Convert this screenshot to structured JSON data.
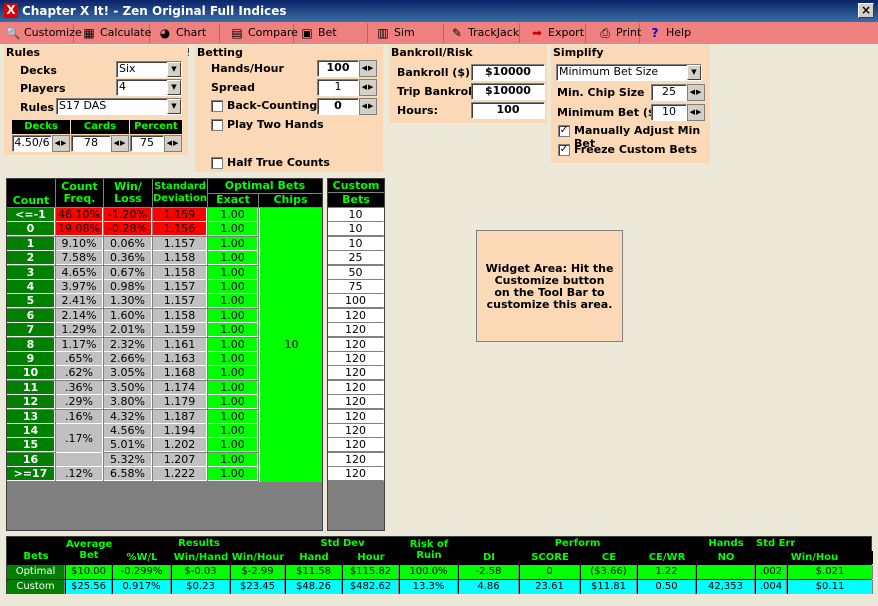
{
  "window": {
    "title": "Chapter X It! - Zen Original Full Indices",
    "close": "×"
  },
  "toolbar": [
    {
      "label": "Customize",
      "icon": "magnifier"
    },
    {
      "label": "Calculate",
      "icon": "calculator"
    },
    {
      "label": "Chart IT!",
      "icon": "pie-chart"
    },
    {
      "label": "Compare",
      "icon": "compare"
    },
    {
      "label": "Bet Report",
      "icon": "report"
    },
    {
      "label": "Sim Parms",
      "icon": "table"
    },
    {
      "label": "TrackJack",
      "icon": "pencil"
    },
    {
      "label": "Export",
      "icon": "export"
    },
    {
      "label": "Print",
      "icon": "printer"
    },
    {
      "label": "Help",
      "icon": "question"
    }
  ],
  "rules": {
    "title": "Rules",
    "decks_label": "Decks",
    "decks": "Six",
    "players_label": "Players",
    "players": "4",
    "rules_label": "Rules",
    "rules": "S17 DAS",
    "sub_headers": [
      "Decks",
      "Cards",
      "Percent"
    ],
    "sub_values": [
      "4.50/6",
      "78",
      "75"
    ]
  },
  "betting": {
    "title": "Betting",
    "hands_label": "Hands/Hour",
    "hands": "100",
    "spread_label": "Spread",
    "spread": "1",
    "backcount_label": "Back-Counting",
    "backcount": "0",
    "twohands_label": "Play Two Hands",
    "halftrue_label": "Half True Counts"
  },
  "bankroll": {
    "title": "Bankroll/Risk",
    "bankroll_label": "Bankroll ($)",
    "bankroll": "$10000",
    "trip_label": "Trip Bankroll",
    "trip": "$10000",
    "hours_label": "Hours:",
    "hours": "100"
  },
  "simplify": {
    "title": "Simplify",
    "mode": "Minimum Bet Size",
    "chip_label": "Min. Chip Size",
    "chip": "25",
    "minbet_label": "Minimum Bet ($)",
    "minbet": "10",
    "manual_label": "Manually Adjust Min Bet",
    "manual_checked": "✓",
    "freeze_label": "Freeze Custom Bets",
    "freeze_checked": "✓"
  },
  "table": {
    "headers": {
      "count": "Count",
      "freq": "Count Freq.",
      "winloss": "Win/ Loss",
      "std": "Standard Deviation",
      "optimal": "Optimal Bets",
      "exact": "Exact",
      "chips": "Chips",
      "custom": "Custom",
      "bets": "Bets"
    },
    "chips_value": "10",
    "rows": [
      {
        "count": "<=-1",
        "freq": "46.10%",
        "wl": "-1.20%",
        "sd": "1.159",
        "exact": "1.00",
        "custom": "10",
        "hl": true
      },
      {
        "count": "0",
        "freq": "19.08%",
        "wl": "-0.28%",
        "sd": "1.156",
        "exact": "1.00",
        "custom": "10",
        "hl": true
      },
      {
        "count": "1",
        "freq": "9.10%",
        "wl": "0.06%",
        "sd": "1.157",
        "exact": "1.00",
        "custom": "10"
      },
      {
        "count": "2",
        "freq": "7.58%",
        "wl": "0.36%",
        "sd": "1.158",
        "exact": "1.00",
        "custom": "25"
      },
      {
        "count": "3",
        "freq": "4.65%",
        "wl": "0.67%",
        "sd": "1.158",
        "exact": "1.00",
        "custom": "50"
      },
      {
        "count": "4",
        "freq": "3.97%",
        "wl": "0.98%",
        "sd": "1.157",
        "exact": "1.00",
        "custom": "75"
      },
      {
        "count": "5",
        "freq": "2.41%",
        "wl": "1.30%",
        "sd": "1.157",
        "exact": "1.00",
        "custom": "100"
      },
      {
        "count": "6",
        "freq": "2.14%",
        "wl": "1.60%",
        "sd": "1.158",
        "exact": "1.00",
        "custom": "120"
      },
      {
        "count": "7",
        "freq": "1.29%",
        "wl": "2.01%",
        "sd": "1.159",
        "exact": "1.00",
        "custom": "120"
      },
      {
        "count": "8",
        "freq": "1.17%",
        "wl": "2.32%",
        "sd": "1.161",
        "exact": "1.00",
        "custom": "120"
      },
      {
        "count": "9",
        "freq": ".65%",
        "wl": "2.66%",
        "sd": "1.163",
        "exact": "1.00",
        "custom": "120"
      },
      {
        "count": "10",
        "freq": ".62%",
        "wl": "3.05%",
        "sd": "1.168",
        "exact": "1.00",
        "custom": "120"
      },
      {
        "count": "11",
        "freq": ".36%",
        "wl": "3.50%",
        "sd": "1.174",
        "exact": "1.00",
        "custom": "120"
      },
      {
        "count": "12",
        "freq": ".29%",
        "wl": "3.80%",
        "sd": "1.179",
        "exact": "1.00",
        "custom": "120"
      },
      {
        "count": "13",
        "freq": ".16%",
        "wl": "4.32%",
        "sd": "1.187",
        "exact": "1.00",
        "custom": "120"
      },
      {
        "count": "14",
        "freq": ".17%",
        "wl": "4.56%",
        "sd": "1.194",
        "exact": "1.00",
        "custom": "120"
      },
      {
        "count": "15",
        "freq": ".07%",
        "wl": "5.01%",
        "sd": "1.202",
        "exact": "1.00",
        "custom": "120"
      },
      {
        "count": "16",
        "freq": "",
        "wl": "5.32%",
        "sd": "1.207",
        "exact": "1.00",
        "custom": "120"
      },
      {
        "count": ">=17",
        "freq": ".12%",
        "wl": "6.58%",
        "sd": "1.222",
        "exact": "1.00",
        "custom": "120"
      }
    ]
  },
  "widget": {
    "text": "Widget Area: Hit the Customize button on the Tool Bar to customize this area."
  },
  "summary": {
    "groups": [
      "Average Bet",
      "Results",
      "Std Dev",
      "Risk of Ruin",
      "Perform",
      "Hands",
      "Std Err"
    ],
    "cols": [
      "Bets",
      "%W/L",
      "Win/Hand",
      "Win/Hour",
      "Hand",
      "Hour",
      "DI",
      "SCORE",
      "CE",
      "CE/WR",
      "NO",
      "%W/L",
      "Win/Hou"
    ],
    "optimal": [
      "Optimal",
      "$10.00",
      "-0.299%",
      "$-0.03",
      "$-2.99",
      "$11.58",
      "$115.82",
      "100.0%",
      "-2.58",
      "0",
      "($3.66)",
      "1.22",
      "",
      "",
      ".002",
      "$.021"
    ],
    "custom": [
      "Custom",
      "$25.56",
      "0.917%",
      "$0.23",
      "$23.45",
      "$48.26",
      "$482.62",
      "13.3%",
      "4.86",
      "23.61",
      "$11.81",
      "0.50",
      "42,353",
      "",
      ".004",
      "$0.11"
    ]
  }
}
